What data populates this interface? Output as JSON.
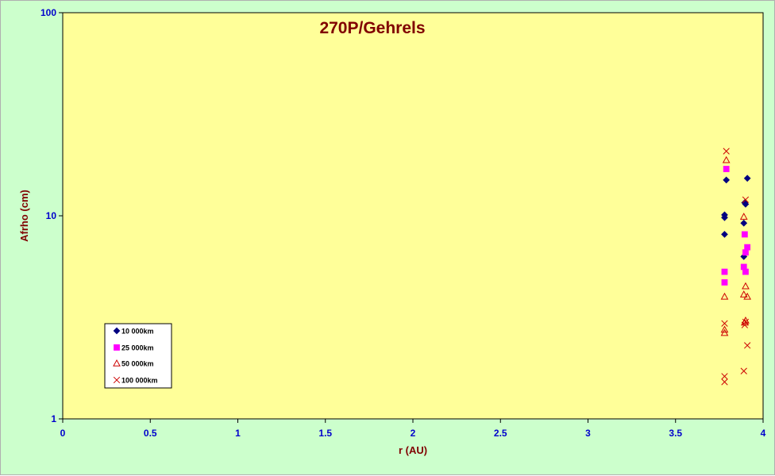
{
  "chart_data": {
    "type": "scatter",
    "title": "270P/Gehrels",
    "xlabel": "r (AU)",
    "ylabel": "Afrho (cm)",
    "xlim": [
      0,
      4
    ],
    "ylim": [
      1,
      100
    ],
    "yscale": "log",
    "x_ticks": [
      "0",
      "0.5",
      "1",
      "1.5",
      "2",
      "2.5",
      "3",
      "3.5",
      "4"
    ],
    "y_ticks": [
      "1",
      "10",
      "100"
    ],
    "grid": false,
    "legend_position": "bottom-left",
    "colors": {
      "plot_background": "#ffff99",
      "chart_background": "#ccffcc",
      "title": "#800000",
      "axis_title": "#800000",
      "tick_labels": "#0000cc"
    },
    "series": [
      {
        "name": "10 000km",
        "marker": "diamond",
        "color": "#000080",
        "points": [
          [
            3.78,
            8.1
          ],
          [
            3.78,
            9.8
          ],
          [
            3.78,
            10.1
          ],
          [
            3.79,
            15.0
          ],
          [
            3.89,
            6.3
          ],
          [
            3.89,
            9.2
          ],
          [
            3.895,
            11.6
          ],
          [
            3.9,
            11.4
          ],
          [
            3.91,
            15.3
          ]
        ]
      },
      {
        "name": "25 000km",
        "marker": "square",
        "color": "#ff00ff",
        "points": [
          [
            3.78,
            4.7
          ],
          [
            3.78,
            5.3
          ],
          [
            3.79,
            17.0
          ],
          [
            3.89,
            5.6
          ],
          [
            3.895,
            8.1
          ],
          [
            3.9,
            5.3
          ],
          [
            3.9,
            6.6
          ],
          [
            3.91,
            7.0
          ]
        ]
      },
      {
        "name": "50 000km",
        "marker": "triangle",
        "color": "#cc0000",
        "points": [
          [
            3.78,
            2.65
          ],
          [
            3.78,
            2.75
          ],
          [
            3.78,
            4.0
          ],
          [
            3.79,
            18.8
          ],
          [
            3.89,
            4.1
          ],
          [
            3.89,
            9.9
          ],
          [
            3.895,
            2.98
          ],
          [
            3.9,
            3.05
          ],
          [
            3.9,
            4.5
          ],
          [
            3.91,
            4.0
          ]
        ]
      },
      {
        "name": "100 000km",
        "marker": "x",
        "color": "#cc0000",
        "points": [
          [
            3.78,
            1.52
          ],
          [
            3.78,
            1.62
          ],
          [
            3.78,
            2.95
          ],
          [
            3.79,
            20.8
          ],
          [
            3.89,
            1.72
          ],
          [
            3.895,
            2.9
          ],
          [
            3.9,
            3.0
          ],
          [
            3.9,
            12.0
          ],
          [
            3.91,
            2.3
          ]
        ]
      }
    ]
  }
}
